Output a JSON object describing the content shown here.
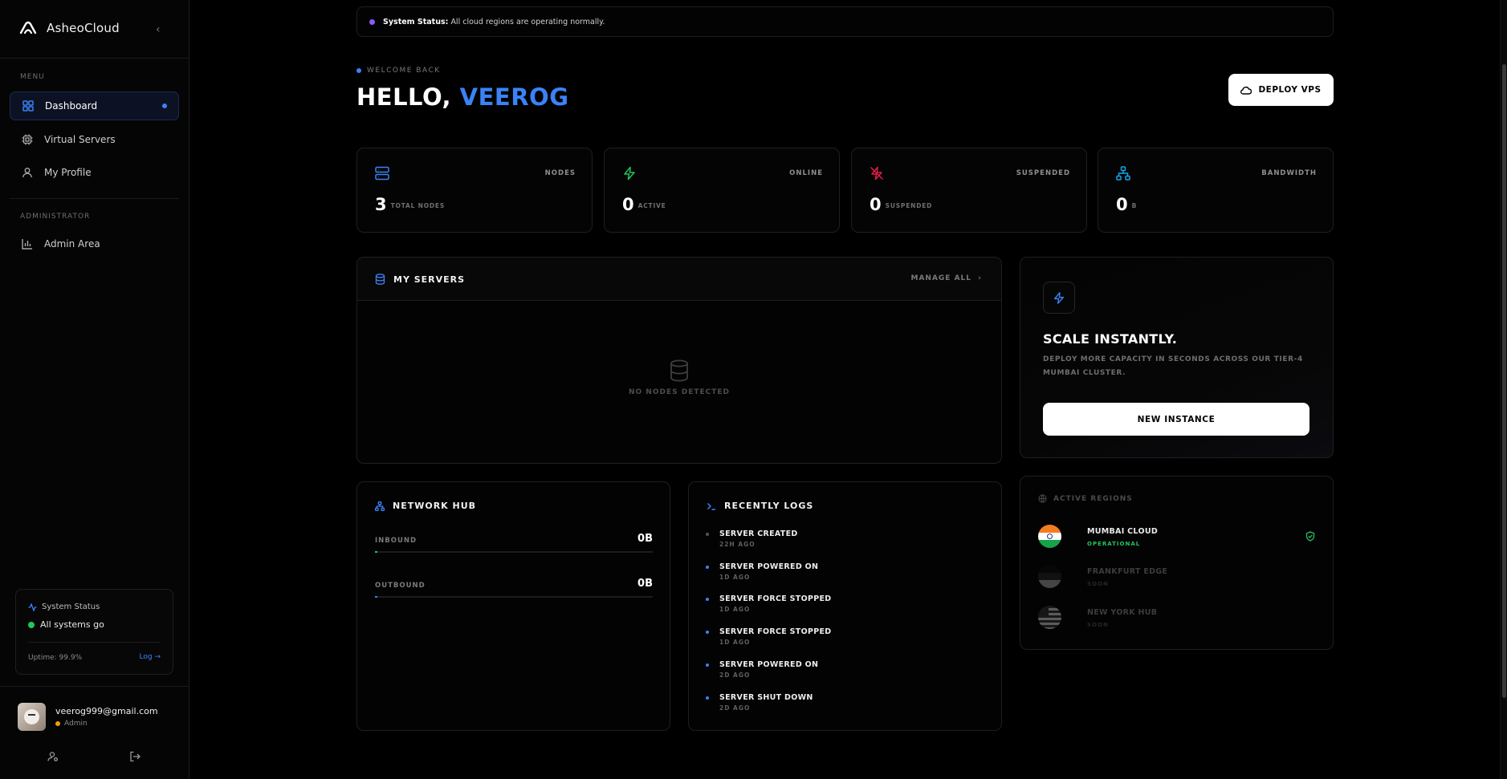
{
  "brand": {
    "name": "AsheoCloud"
  },
  "sidebar": {
    "menu_heading": "MENU",
    "items": [
      {
        "label": "Dashboard",
        "icon": "grid-icon",
        "active": true
      },
      {
        "label": "Virtual Servers",
        "icon": "cpu-icon"
      },
      {
        "label": "My Profile",
        "icon": "user-icon"
      }
    ],
    "admin_heading": "ADMINISTRATOR",
    "admin_items": [
      {
        "label": "Admin Area",
        "icon": "bar-chart-icon"
      }
    ],
    "status": {
      "title": "System Status",
      "message": "All systems go",
      "uptime": "Uptime: 99.9%",
      "log_link": "Log →"
    },
    "user": {
      "email": "veerog999@gmail.com",
      "role": "Admin"
    }
  },
  "banner": {
    "label": "System Status:",
    "message": "All cloud regions are operating normally."
  },
  "header": {
    "welcome": "WELCOME BACK",
    "greeting": "HELLO,",
    "name": "VEEROG",
    "deploy_label": "DEPLOY VPS"
  },
  "stats": [
    {
      "label": "NODES",
      "value": "3",
      "sub": "TOTAL NODES",
      "icon": "server-icon",
      "color": "#3b82f6"
    },
    {
      "label": "ONLINE",
      "value": "0",
      "sub": "ACTIVE",
      "icon": "bolt-icon",
      "color": "#22c55e"
    },
    {
      "label": "SUSPENDED",
      "value": "0",
      "sub": "SUSPENDED",
      "icon": "bolt-off-icon",
      "color": "#e11d48"
    },
    {
      "label": "BANDWIDTH",
      "value": "0",
      "sub": "B",
      "icon": "network-icon",
      "color": "#0ea5e9"
    }
  ],
  "servers": {
    "title": "MY SERVERS",
    "manage_label": "MANAGE ALL",
    "empty_text": "NO NODES DETECTED"
  },
  "scale": {
    "title": "SCALE INSTANTLY.",
    "subtitle": "DEPLOY MORE CAPACITY IN SECONDS ACROSS OUR TIER-4 MUMBAI CLUSTER.",
    "button": "NEW INSTANCE"
  },
  "network": {
    "title": "NETWORK HUB",
    "rows": [
      {
        "label": "INBOUND",
        "value": "0B",
        "fill": 0.0,
        "color": "#22c55e"
      },
      {
        "label": "OUTBOUND",
        "value": "0B",
        "fill": 0.0,
        "color": "#3b82f6"
      }
    ]
  },
  "logs": {
    "title": "RECENTLY LOGS",
    "items": [
      {
        "title": "SERVER CREATED",
        "ago": "22H AGO",
        "color": "#555555"
      },
      {
        "title": "SERVER POWERED ON",
        "ago": "1D AGO",
        "color": "#3b82f6"
      },
      {
        "title": "SERVER FORCE STOPPED",
        "ago": "1D AGO",
        "color": "#3b82f6"
      },
      {
        "title": "SERVER FORCE STOPPED",
        "ago": "1D AGO",
        "color": "#3b82f6"
      },
      {
        "title": "SERVER POWERED ON",
        "ago": "2D AGO",
        "color": "#3b82f6"
      },
      {
        "title": "SERVER SHUT DOWN",
        "ago": "2D AGO",
        "color": "#3b82f6"
      }
    ]
  },
  "regions": {
    "title": "ACTIVE REGIONS",
    "items": [
      {
        "name": "MUMBAI CLOUD",
        "status": "OPERATIONAL"
      },
      {
        "name": "FRANKFURT EDGE",
        "status": "SOON"
      },
      {
        "name": "NEW YORK HUB",
        "status": "SOON"
      }
    ]
  }
}
